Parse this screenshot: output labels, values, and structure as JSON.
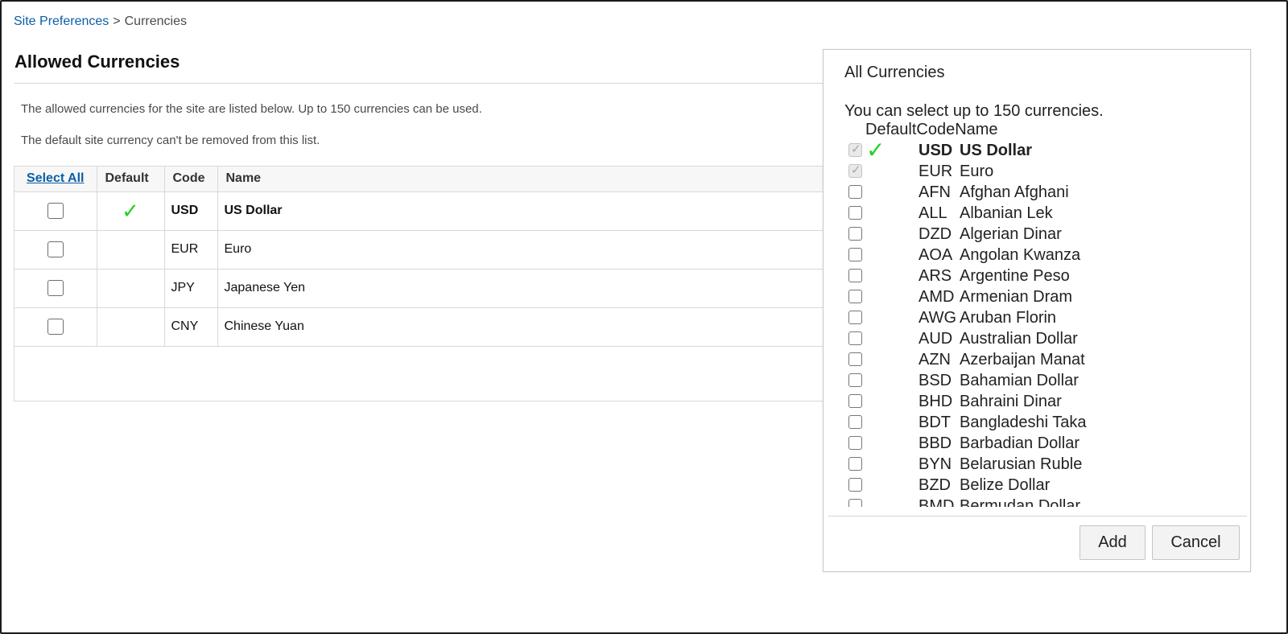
{
  "breadcrumb": {
    "parent": "Site Preferences",
    "separator": ">",
    "current": "Currencies"
  },
  "page": {
    "title": "Allowed Currencies",
    "info1": "The allowed currencies for the site are listed below. Up to 150 currencies can be used.",
    "info2": "The default site currency can't be removed from this list."
  },
  "table": {
    "headers": {
      "select_all": "Select All",
      "default": "Default",
      "code": "Code",
      "name": "Name"
    },
    "rows": [
      {
        "code": "USD",
        "name": "US Dollar",
        "default": true
      },
      {
        "code": "EUR",
        "name": "Euro",
        "default": false
      },
      {
        "code": "JPY",
        "name": "Japanese Yen",
        "default": false
      },
      {
        "code": "CNY",
        "name": "Chinese Yuan",
        "default": false
      }
    ]
  },
  "check_glyph": "✓",
  "colors": {
    "accent_link": "#0a5fa8",
    "default_check": "#22d11e"
  },
  "modal": {
    "title": "All Currencies",
    "note": "You can select up to 150 currencies.",
    "headers": {
      "default": "Default",
      "code": "Code",
      "name": "Name"
    },
    "items": [
      {
        "code": "USD",
        "name": "US Dollar",
        "default": true,
        "locked": true
      },
      {
        "code": "EUR",
        "name": "Euro",
        "default": false,
        "locked": true
      },
      {
        "code": "AFN",
        "name": "Afghan Afghani"
      },
      {
        "code": "ALL",
        "name": "Albanian Lek"
      },
      {
        "code": "DZD",
        "name": "Algerian Dinar"
      },
      {
        "code": "AOA",
        "name": "Angolan Kwanza"
      },
      {
        "code": "ARS",
        "name": "Argentine Peso"
      },
      {
        "code": "AMD",
        "name": "Armenian Dram"
      },
      {
        "code": "AWG",
        "name": "Aruban Florin"
      },
      {
        "code": "AUD",
        "name": "Australian Dollar"
      },
      {
        "code": "AZN",
        "name": "Azerbaijan Manat"
      },
      {
        "code": "BSD",
        "name": "Bahamian Dollar"
      },
      {
        "code": "BHD",
        "name": "Bahraini Dinar"
      },
      {
        "code": "BDT",
        "name": "Bangladeshi Taka"
      },
      {
        "code": "BBD",
        "name": "Barbadian Dollar"
      },
      {
        "code": "BYN",
        "name": "Belarusian Ruble"
      },
      {
        "code": "BZD",
        "name": "Belize Dollar"
      },
      {
        "code": "BMD",
        "name": "Bermudan Dollar"
      }
    ],
    "add_label": "Add",
    "cancel_label": "Cancel"
  }
}
